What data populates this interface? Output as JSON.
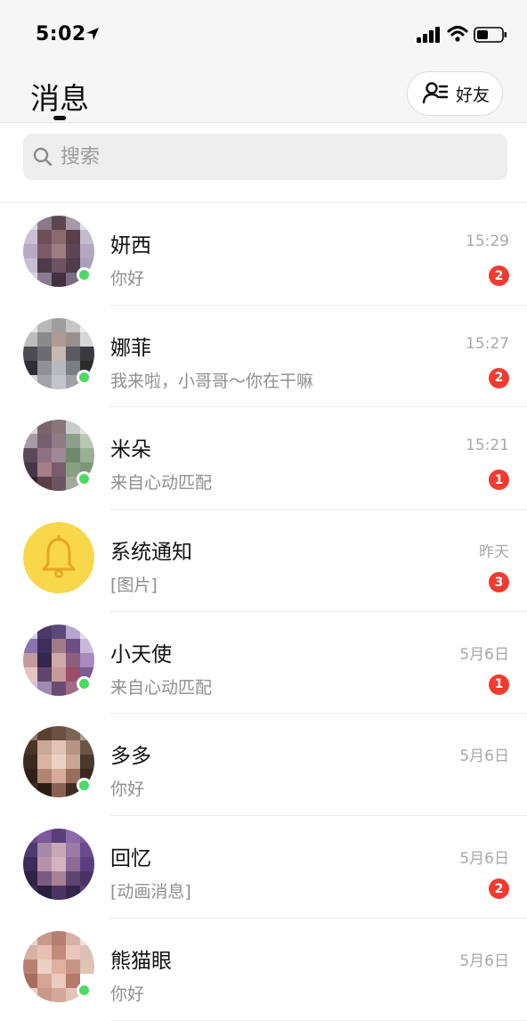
{
  "status_bar": {
    "time": "5:02",
    "icons": [
      "location-arrow-icon",
      "signal-icon",
      "wifi-icon",
      "battery-icon"
    ]
  },
  "header": {
    "title": "消息",
    "friends_button_label": "好友",
    "friends_icon": "contacts-icon"
  },
  "search": {
    "placeholder": "搜索",
    "icon": "search-icon"
  },
  "colors": {
    "background": "#ffffff",
    "header_bg": "#f6f6f6",
    "badge": "#f23b30",
    "online": "#4cd964",
    "notification_avatar": "#f8d84a"
  },
  "conversations": [
    {
      "name": "妍西",
      "time": "15:29",
      "preview": "你好",
      "unread": "2",
      "online": true,
      "avatar": "pixelated-photo"
    },
    {
      "name": "娜菲",
      "time": "15:27",
      "preview": "我来啦，小哥哥～你在干嘛",
      "unread": "2",
      "online": true,
      "avatar": "pixelated-photo"
    },
    {
      "name": "米朵",
      "time": "15:21",
      "preview": "来自心动匹配",
      "unread": "1",
      "online": true,
      "avatar": "pixelated-photo"
    },
    {
      "name": "系统通知",
      "time": "昨天",
      "preview": "[图片]",
      "unread": "3",
      "online": false,
      "avatar": "bell-icon"
    },
    {
      "name": "小天使",
      "time": "5月6日",
      "preview": "来自心动匹配",
      "unread": "1",
      "online": true,
      "avatar": "pixelated-photo"
    },
    {
      "name": "多多",
      "time": "5月6日",
      "preview": "你好",
      "unread": "",
      "online": true,
      "avatar": "pixelated-photo"
    },
    {
      "name": "回忆",
      "time": "5月6日",
      "preview": "[动画消息]",
      "unread": "2",
      "online": false,
      "avatar": "pixelated-photo"
    },
    {
      "name": "熊猫眼",
      "time": "5月6日",
      "preview": "你好",
      "unread": "",
      "online": true,
      "avatar": "pixelated-photo"
    }
  ]
}
